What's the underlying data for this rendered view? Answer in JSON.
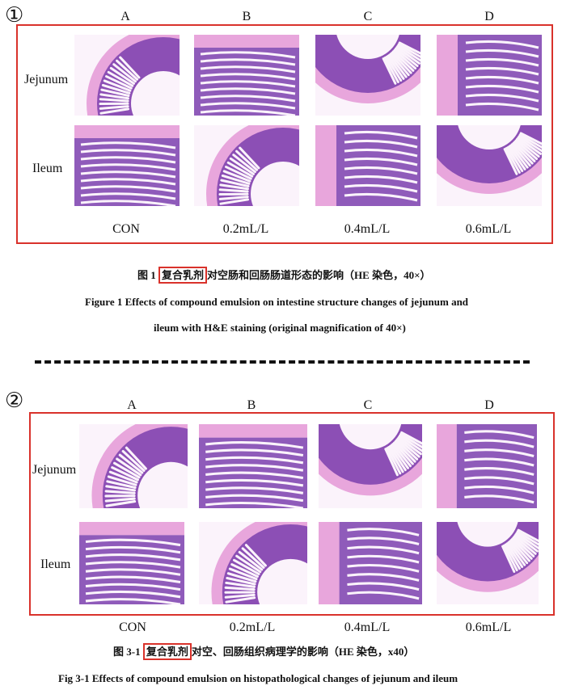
{
  "sections": [
    {
      "marker": "①",
      "columns": [
        "A",
        "B",
        "C",
        "D"
      ],
      "rows": [
        "Jejunum",
        "Ileum"
      ],
      "conditions": [
        "CON",
        "0.2mL/L",
        "0.4mL/L",
        "0.6mL/L"
      ],
      "caption_cn": {
        "prefix": "图 1 ",
        "highlight": "复合乳剂",
        "suffix": "对空肠和回肠肠道形态的影响（HE 染色，40×）"
      },
      "caption_en": [
        "Figure 1 Effects of compound emulsion on intestine structure changes of jejunum and",
        "ileum with H&E staining (original magnification of 40×)"
      ]
    },
    {
      "marker": "②",
      "columns": [
        "A",
        "B",
        "C",
        "D"
      ],
      "rows": [
        "Jejunum",
        "Ileum"
      ],
      "conditions": [
        "CON",
        "0.2mL/L",
        "0.4mL/L",
        "0.6mL/L"
      ],
      "caption_cn": {
        "prefix": "图 3-1 ",
        "highlight": "复合乳剂",
        "suffix": "对空、回肠组织病理学的影响（HE 染色，x40）"
      },
      "caption_en": [
        "Fig 3-1 Effects of compound emulsion on histopathological changes of jejunum and ileum"
      ]
    }
  ],
  "colors": {
    "highlight_border": "#d9322b",
    "tissue_pink": "#e8a6dc",
    "tissue_purple": "#7b3fae",
    "background": "#f3e6f3"
  }
}
